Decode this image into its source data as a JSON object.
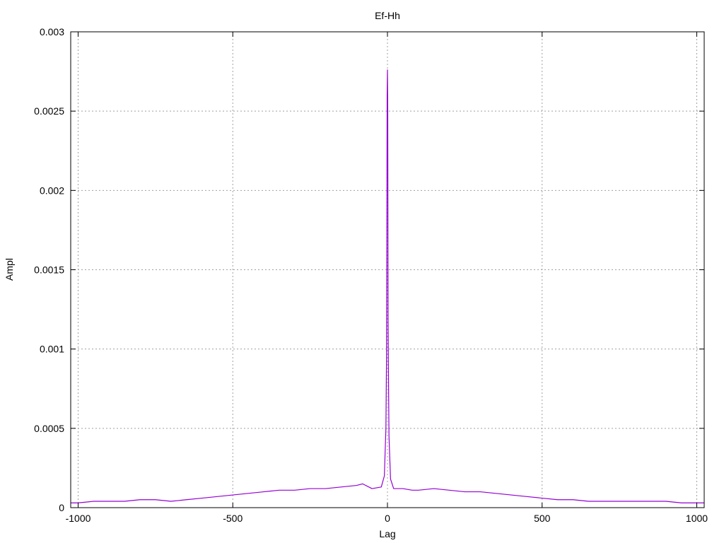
{
  "chart_data": {
    "type": "line",
    "title": "Ef-Hh",
    "xlabel": "Lag",
    "ylabel": "Ampl",
    "xlim": [
      -1024,
      1024
    ],
    "ylim": [
      0,
      0.003
    ],
    "grid": true,
    "x_ticks": [
      -1000,
      -500,
      0,
      500,
      1000
    ],
    "x_tick_labels": [
      "-1000",
      "-500",
      "0",
      "500",
      "1000"
    ],
    "y_ticks": [
      0,
      0.0005,
      0.001,
      0.0015,
      0.002,
      0.0025,
      0.003
    ],
    "y_tick_labels": [
      "0",
      "0.0005",
      "0.001",
      "0.0015",
      "0.002",
      "0.0025",
      "0.003"
    ],
    "line_color": "#9400d3",
    "grid_color": "#a0a0a0",
    "series": [
      {
        "x": [
          -1024,
          -1000,
          -950,
          -900,
          -850,
          -800,
          -750,
          -700,
          -650,
          -600,
          -550,
          -500,
          -450,
          -400,
          -350,
          -300,
          -250,
          -200,
          -150,
          -100,
          -80,
          -50,
          -20,
          -10,
          -5,
          -3,
          -2,
          -1,
          0,
          1,
          2,
          3,
          5,
          10,
          20,
          50,
          80,
          100,
          150,
          200,
          250,
          300,
          350,
          400,
          450,
          500,
          550,
          600,
          650,
          700,
          750,
          800,
          850,
          900,
          950,
          1000,
          1024
        ],
        "values": [
          3e-05,
          3e-05,
          4e-05,
          4e-05,
          4e-05,
          5e-05,
          5e-05,
          4e-05,
          5e-05,
          6e-05,
          7e-05,
          8e-05,
          9e-05,
          0.0001,
          0.00011,
          0.00011,
          0.00012,
          0.00012,
          0.00013,
          0.00014,
          0.00015,
          0.00012,
          0.00013,
          0.0002,
          0.0005,
          0.00095,
          0.0018,
          0.0026,
          0.00276,
          0.0025,
          0.0012,
          0.0009,
          0.00045,
          0.00018,
          0.00012,
          0.00012,
          0.00011,
          0.00011,
          0.00012,
          0.00011,
          0.0001,
          0.0001,
          9e-05,
          8e-05,
          7e-05,
          6e-05,
          5e-05,
          5e-05,
          4e-05,
          4e-05,
          4e-05,
          4e-05,
          4e-05,
          4e-05,
          3e-05,
          3e-05,
          3e-05
        ]
      }
    ]
  }
}
